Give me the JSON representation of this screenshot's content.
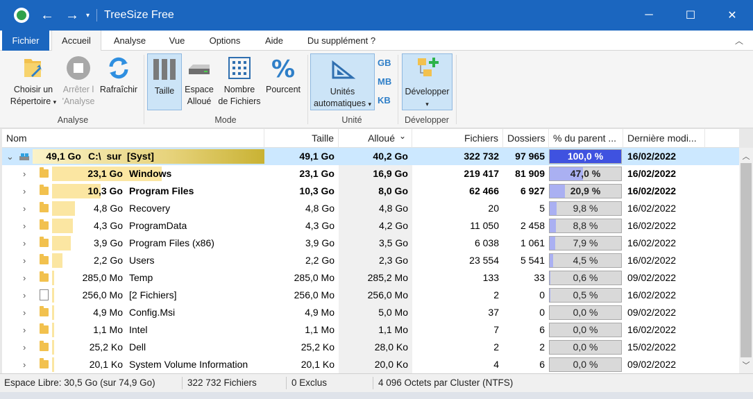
{
  "window": {
    "title": "TreeSize Free",
    "colors": {
      "titlebar": "#1b66bf",
      "accent": "#1b66bf",
      "selection": "#cce8ff"
    }
  },
  "quick_access": {
    "back_icon": "←",
    "forward_icon": "→",
    "dropdown_icon": "▾"
  },
  "window_controls": {
    "minimize_icon": "─",
    "maximize_icon": "☐",
    "close_icon": "✕"
  },
  "tabs": [
    {
      "label": "Fichier"
    },
    {
      "label": "Accueil"
    },
    {
      "label": "Analyse"
    },
    {
      "label": "Vue"
    },
    {
      "label": "Options"
    },
    {
      "label": "Aide"
    },
    {
      "label": "Du supplément ?"
    }
  ],
  "ribbon": {
    "analyse_group": {
      "label": "Analyse",
      "choose_line1": "Choisir un",
      "choose_line2": "Répertoire",
      "stop_line1": "Arrêter l",
      "stop_line2": "'Analyse",
      "refresh": "Rafraîchir"
    },
    "mode_group": {
      "label": "Mode",
      "size": "Taille",
      "alloc_line1": "Espace",
      "alloc_line2": "Alloué",
      "files_line1": "Nombre",
      "files_line2": "de Fichiers",
      "percent": "Pourcent"
    },
    "unit_group": {
      "label": "Unité",
      "auto_line1": "Unités",
      "auto_line2": "automatiques",
      "gb": "GB",
      "mb": "MB",
      "kb": "KB"
    },
    "dev_group": {
      "label": "Développer",
      "expand": "Développer"
    }
  },
  "columns": {
    "name": "Nom",
    "size": "Taille",
    "alloc": "Alloué",
    "alloc_sort_icon": "⌄",
    "files": "Fichiers",
    "folders": "Dossiers",
    "percent": "% du parent ...",
    "modified": "Dernière modi..."
  },
  "rows": [
    {
      "indicator": "49,1 Go",
      "name": "C:\\  sur  [Syst]",
      "size": "49,1 Go",
      "alloc": "40,2 Go",
      "files": "322 732",
      "folders": "97 965",
      "pct_label": "100,0 %",
      "pct": 100.0,
      "modified": "16/02/2022"
    },
    {
      "indicator": "23,1 Go",
      "name": "Windows",
      "size": "23,1 Go",
      "alloc": "16,9 Go",
      "files": "219 417",
      "folders": "81 909",
      "pct_label": "47,0 %",
      "pct": 47.0,
      "modified": "16/02/2022"
    },
    {
      "indicator": "10,3 Go",
      "name": "Program Files",
      "size": "10,3 Go",
      "alloc": "8,0 Go",
      "files": "62 466",
      "folders": "6 927",
      "pct_label": "20,9 %",
      "pct": 20.9,
      "modified": "16/02/2022"
    },
    {
      "indicator": "4,8 Go",
      "name": "Recovery",
      "size": "4,8 Go",
      "alloc": "4,8 Go",
      "files": "20",
      "folders": "5",
      "pct_label": "9,8 %",
      "pct": 9.8,
      "modified": "16/02/2022"
    },
    {
      "indicator": "4,3 Go",
      "name": "ProgramData",
      "size": "4,3 Go",
      "alloc": "4,2 Go",
      "files": "11 050",
      "folders": "2 458",
      "pct_label": "8,8 %",
      "pct": 8.8,
      "modified": "16/02/2022"
    },
    {
      "indicator": "3,9 Go",
      "name": "Program Files (x86)",
      "size": "3,9 Go",
      "alloc": "3,5 Go",
      "files": "6 038",
      "folders": "1 061",
      "pct_label": "7,9 %",
      "pct": 7.9,
      "modified": "16/02/2022"
    },
    {
      "indicator": "2,2 Go",
      "name": "Users",
      "size": "2,2 Go",
      "alloc": "2,3 Go",
      "files": "23 554",
      "folders": "5 541",
      "pct_label": "4,5 %",
      "pct": 4.5,
      "modified": "16/02/2022"
    },
    {
      "indicator": "285,0 Mo",
      "name": "Temp",
      "size": "285,0 Mo",
      "alloc": "285,2 Mo",
      "files": "133",
      "folders": "33",
      "pct_label": "0,6 %",
      "pct": 0.6,
      "modified": "09/02/2022"
    },
    {
      "indicator": "256,0 Mo",
      "name": "[2 Fichiers]",
      "size": "256,0 Mo",
      "alloc": "256,0 Mo",
      "files": "2",
      "folders": "0",
      "pct_label": "0,5 %",
      "pct": 0.5,
      "modified": "16/02/2022"
    },
    {
      "indicator": "4,9 Mo",
      "name": "Config.Msi",
      "size": "4,9 Mo",
      "alloc": "5,0 Mo",
      "files": "37",
      "folders": "0",
      "pct_label": "0,0 %",
      "pct": 0.0,
      "modified": "09/02/2022"
    },
    {
      "indicator": "1,1 Mo",
      "name": "Intel",
      "size": "1,1 Mo",
      "alloc": "1,1 Mo",
      "files": "7",
      "folders": "6",
      "pct_label": "0,0 %",
      "pct": 0.0,
      "modified": "16/02/2022"
    },
    {
      "indicator": "25,2 Ko",
      "name": "Dell",
      "size": "25,2 Ko",
      "alloc": "28,0 Ko",
      "files": "2",
      "folders": "2",
      "pct_label": "0,0 %",
      "pct": 0.0,
      "modified": "15/02/2022"
    },
    {
      "indicator": "20,1 Ko",
      "name": "System Volume Information",
      "size": "20,1 Ko",
      "alloc": "20,0 Ko",
      "files": "4",
      "folders": "6",
      "pct_label": "0,0 %",
      "pct": 0.0,
      "modified": "09/02/2022"
    }
  ],
  "status": {
    "free": "Espace Libre: 30,5 Go  (sur 74,9 Go)",
    "files": "322 732 Fichiers",
    "excluded": "0 Exclus",
    "cluster": "4 096 Octets par Cluster (NTFS)"
  }
}
